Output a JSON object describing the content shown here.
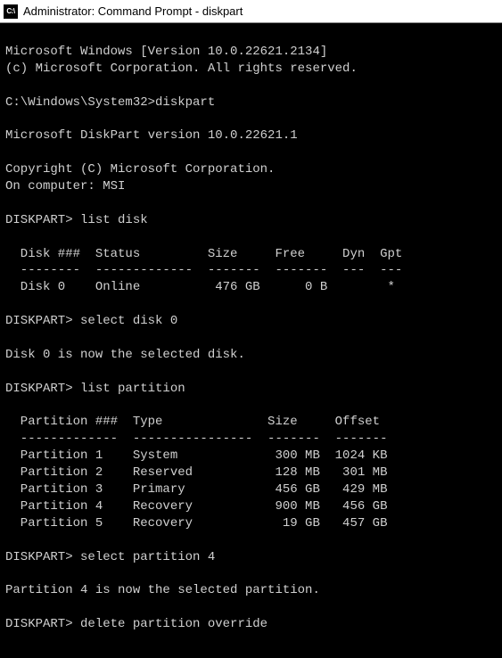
{
  "window": {
    "icon_label": "C:\\",
    "title": "Administrator: Command Prompt - diskpart"
  },
  "lines": {
    "l01": "Microsoft Windows [Version 10.0.22621.2134]",
    "l02": "(c) Microsoft Corporation. All rights reserved.",
    "l03": "",
    "l04": "C:\\Windows\\System32>diskpart",
    "l05": "",
    "l06": "Microsoft DiskPart version 10.0.22621.1",
    "l07": "",
    "l08": "Copyright (C) Microsoft Corporation.",
    "l09": "On computer: MSI",
    "l10": "",
    "l11": "DISKPART> list disk",
    "l12": "",
    "l13": "  Disk ###  Status         Size     Free     Dyn  Gpt",
    "l14": "  --------  -------------  -------  -------  ---  ---",
    "l15": "  Disk 0    Online          476 GB      0 B        *",
    "l16": "",
    "l17": "DISKPART> select disk 0",
    "l18": "",
    "l19": "Disk 0 is now the selected disk.",
    "l20": "",
    "l21": "DISKPART> list partition",
    "l22": "",
    "l23": "  Partition ###  Type              Size     Offset",
    "l24": "  -------------  ----------------  -------  -------",
    "l25": "  Partition 1    System             300 MB  1024 KB",
    "l26": "  Partition 2    Reserved           128 MB   301 MB",
    "l27": "  Partition 3    Primary            456 GB   429 MB",
    "l28": "  Partition 4    Recovery           900 MB   456 GB",
    "l29": "  Partition 5    Recovery            19 GB   457 GB",
    "l30": "",
    "l31": "DISKPART> select partition 4",
    "l32": "",
    "l33": "Partition 4 is now the selected partition.",
    "l34": "",
    "l35": "DISKPART> delete partition override",
    "l36": ""
  }
}
